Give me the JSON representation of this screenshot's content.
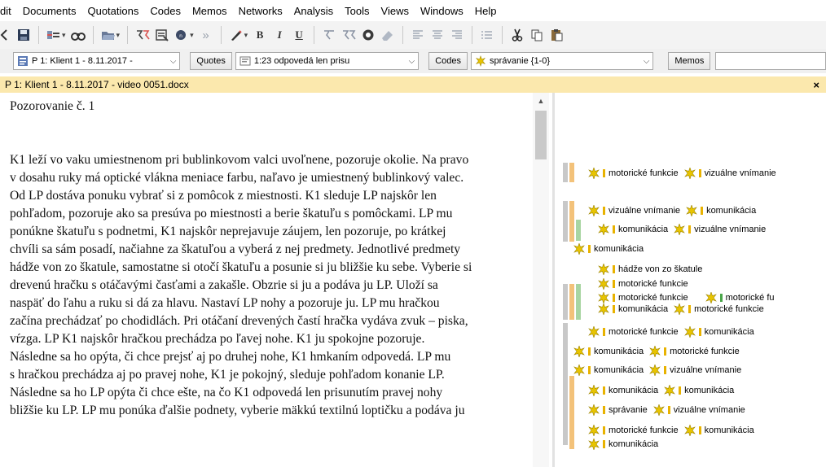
{
  "menu": [
    "dit",
    "Documents",
    "Quotations",
    "Codes",
    "Memos",
    "Networks",
    "Analysis",
    "Tools",
    "Views",
    "Windows",
    "Help"
  ],
  "toolbar": {
    "overflow": "»",
    "bold": "B",
    "italic": "I",
    "underline": "U"
  },
  "selectors": {
    "document": "P 1: Klient 1 - 8.11.2017 -",
    "quotes_button": "Quotes",
    "quotation": "1:23 odpovedá len prisu",
    "codes_button": "Codes",
    "code": "správanie {1-0}",
    "memos_button": "Memos"
  },
  "document_title": "P 1: Klient 1 - 8.11.2017 - video 0051.docx",
  "close_label": "×",
  "document": {
    "heading": "Pozorovanie č. 1",
    "lines": [
      "K1 leží vo vaku umiestnenom pri bublinkovom valci uvoľnene, pozoruje okolie. Na pravo",
      "v dosahu ruky má optické vlákna meniace farbu, naľavo je umiestnený bublinkový valec.",
      "Od LP dostáva ponuku vybrať si z pomôcok z miestnosti. K1 sleduje LP najskôr len",
      "pohľadom, pozoruje ako sa presúva po miestnosti a berie škatuľu s pomôckami. LP mu",
      "ponúkne škatuľu s podnetmi, K1 najskôr neprejavuje záujem, len pozoruje, po krátkej",
      "chvíli sa sám posadí, načiahne za škatuľou a vyberá z nej predmety. Jednotlivé predmety",
      "hádže von zo škatule, samostatne si otočí škatuľu a posunie si ju bližšie ku sebe. Vyberie si",
      "drevenú hračku s otáčavými časťami a zakašle. Obzrie si ju a podáva ju LP. Uloží sa",
      "naspäť do ľahu a ruku si dá za hlavu. Nastaví LP nohy a pozoruje ju. LP mu hračkou",
      "začína prechádzať po chodidlách. Pri otáčaní drevených častí hračka vydáva zvuk – piska,",
      "vŕzga. LP K1 najskôr hračkou prechádza po ľavej nohe. K1 ju spokojne pozoruje.",
      "Následne sa ho opýta, či chce prejsť aj po druhej nohe, K1 hmkaním odpovedá. LP mu",
      "s hračkou prechádza aj po pravej nohe, K1 je pokojný, sleduje pohľadom konanie LP.",
      "Následne sa ho LP opýta či chce ešte, na čo K1 odpovedá len prisunutím pravej nohy",
      "bližšie ku LP. LP mu ponúka ďalšie podnety, vyberie mäkkú textilnú loptičku a podáva ju"
    ]
  },
  "margin_codes": [
    [
      "motorické funkcie",
      "vizuálne vnímanie"
    ],
    [
      "vizuálne vnímanie",
      "komunikácia"
    ],
    [
      "komunikácia",
      "vizuálne vnímanie"
    ],
    [
      "komunikácia"
    ],
    [
      "hádže von zo škatule"
    ],
    [
      "motorické funkcie"
    ],
    [
      "motorické funkcie",
      "motorické fu"
    ],
    [
      "komunikácia",
      "motorické funkcie"
    ],
    [
      "motorické funkcie",
      "komunikácia"
    ],
    [
      "komunikácia",
      "motorické funkcie"
    ],
    [
      "komunikácia",
      "vizuálne vnímanie"
    ],
    [
      "komunikácia",
      "komunikácia"
    ],
    [
      "správanie",
      "vizuálne vnímanie"
    ],
    [
      "motorické funkcie",
      "komunikácia"
    ],
    [
      "komunikácia"
    ]
  ],
  "colors": {
    "title_bar": "#fbe8ad",
    "code_star": "#e8c400",
    "bar_gray": "#c8c8c8",
    "bar_orange": "#f3c27a",
    "bar_green": "#a8d5a2"
  }
}
